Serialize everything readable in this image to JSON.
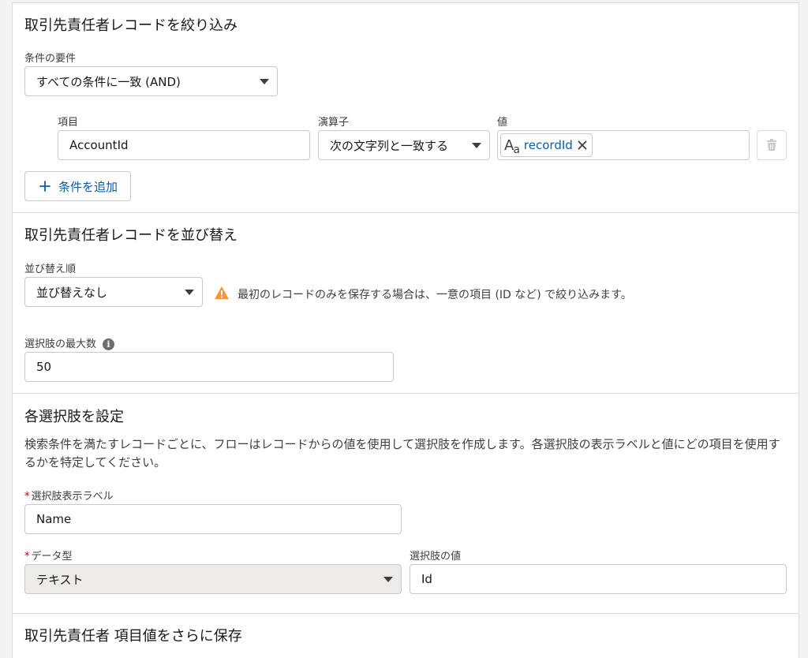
{
  "filter_section": {
    "title": "取引先責任者レコードを絞り込み",
    "requirement_label": "条件の要件",
    "requirement_value": "すべての条件に一致 (AND)",
    "col_field": "項目",
    "col_operator": "演算子",
    "col_value": "値",
    "condition": {
      "field": "AccountId",
      "operator": "次の文字列と一致する",
      "value_token": "recordId",
      "value_type_glyph": "A",
      "value_type_glyph_small": "a"
    },
    "add_condition_label": "条件を追加"
  },
  "sort_section": {
    "title": "取引先責任者レコードを並び替え",
    "order_label": "並び替え順",
    "order_value": "並び替えなし",
    "warning": "最初のレコードのみを保存する場合は、一意の項目 (ID など) で絞り込みます。",
    "max_label": "選択肢の最大数",
    "max_value": "50"
  },
  "choice_section": {
    "title": "各選択肢を設定",
    "description": "検索条件を満たすレコードごとに、フローはレコードからの値を使用して選択肢を作成します。各選択肢の表示ラベルと値にどの項目を使用するかを特定してください。",
    "display_label_label": "選択肢表示ラベル",
    "display_label_value": "Name",
    "data_type_label": "データ型",
    "data_type_value": "テキスト",
    "choice_value_label": "選択肢の値",
    "choice_value_value": "Id",
    "required_mark": "*"
  },
  "store_section": {
    "title": "取引先責任者 項目値をさらに保存"
  },
  "colors": {
    "link_blue": "#0b5cab",
    "warning_yellow": "#fe9339",
    "required_red": "#ba0517"
  }
}
